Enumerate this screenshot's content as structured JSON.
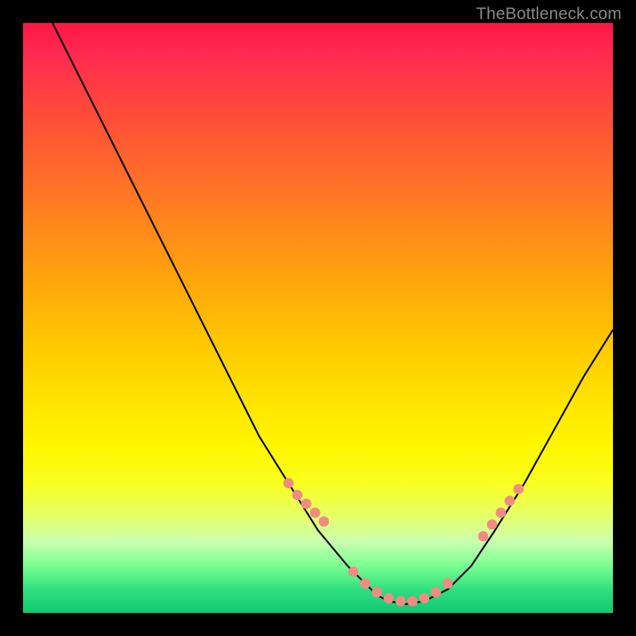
{
  "watermark": "TheBottleneck.com",
  "chart_data": {
    "type": "line",
    "title": "",
    "xlabel": "",
    "ylabel": "",
    "xlim": [
      0,
      100
    ],
    "ylim": [
      0,
      100
    ],
    "series": [
      {
        "name": "curve",
        "x": [
          5,
          10,
          15,
          20,
          25,
          30,
          35,
          40,
          45,
          50,
          55,
          58,
          60,
          62,
          65,
          68,
          72,
          76,
          80,
          85,
          90,
          95,
          100
        ],
        "values": [
          100,
          90,
          80,
          70,
          60,
          50,
          40,
          30,
          22,
          14,
          8,
          5,
          3,
          2,
          1.5,
          2,
          4,
          8,
          14,
          22,
          31,
          40,
          48
        ]
      }
    ],
    "markers": {
      "name": "dots",
      "color": "#f28b82",
      "x": [
        45,
        46.5,
        48,
        49.5,
        51,
        56,
        58,
        60,
        62,
        64,
        66,
        68,
        70,
        72,
        78,
        79.5,
        81,
        82.5,
        84
      ],
      "values": [
        22,
        20,
        18.5,
        17,
        15.5,
        7,
        5,
        3.5,
        2.5,
        2,
        2,
        2.5,
        3.5,
        5,
        13,
        15,
        17,
        19,
        21
      ]
    }
  }
}
